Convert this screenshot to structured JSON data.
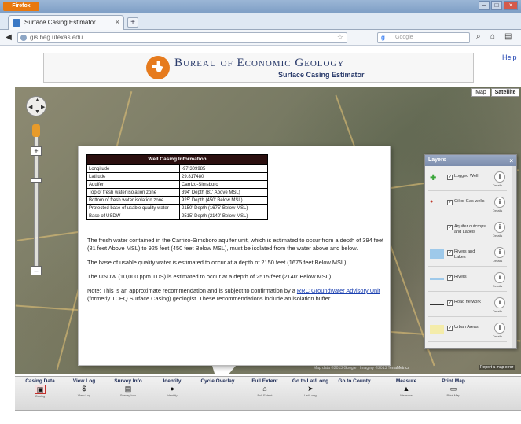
{
  "browser": {
    "app_button": "Firefox",
    "tab_title": "Surface Casing Estimator",
    "new_tab": "+",
    "url_prefix": "gis.beg.utexas.edu",
    "url_domain": "utexas.edu",
    "search_logo": "g",
    "search_placeholder": "Google"
  },
  "header": {
    "org_title": "Bureau of Economic Geology",
    "subtitle": "Surface Casing Estimator",
    "help_link": "Help"
  },
  "map": {
    "type_map": "Map",
    "type_satellite": "Satellite",
    "attribution": "Map data ©2013 Google · Imagery ©2013 TerraMetrics",
    "report_link": "Report a map error"
  },
  "well_info": {
    "title": "Well Casing Information",
    "rows": [
      {
        "label": "Longitude",
        "value": "-97.309985"
      },
      {
        "label": "Latitude",
        "value": "29.817480"
      },
      {
        "label": "Aquifer",
        "value": "Carrizo-Simsboro"
      },
      {
        "label": "Top of fresh water isolation zone",
        "value": "394' Depth (81' Above MSL)"
      },
      {
        "label": "Bottom of fresh water isolation zone",
        "value": "925' Depth (450' Below MSL)"
      },
      {
        "label": "Protected base of usable quality water",
        "value": "2150' Depth (1675' Below MSL)"
      },
      {
        "label": "Base of USDW",
        "value": "2515' Depth (2140' Below MSL)"
      }
    ],
    "para1": "The fresh water contained in the Carrizo-Simsboro aquifer unit, which is estimated to occur from a depth of 394 feet (81 feet Above MSL) to 925 feet (450 feet Below MSL), must be isolated from the water above and below.",
    "para2": "The base of usable quality water is estimated to occur at a depth of 2150 feet (1675 feet Below MSL).",
    "para3": "The USDW (10,000 ppm TDS) is estimated to occur at a depth of 2515 feet (2140' Below MSL).",
    "note_prefix": "Note: This is an approximate recommendation and is subject to confirmation by a ",
    "note_link": "RRC Groundwater Advisory Unit",
    "note_suffix": " (formerly TCEQ Surface Casing) geologist. These recommendations include an isolation buffer."
  },
  "layers": {
    "title": "Layers",
    "info_sub": "Details",
    "items": [
      {
        "label": "Logged Well",
        "color": "#3aa63a"
      },
      {
        "label": "Oil or Gas wells",
        "color": "#c0392b"
      },
      {
        "label": "Aquifer outcrops and Labels",
        "color": "#eeeeee"
      },
      {
        "label": "Rivers and Lakes",
        "color": "#9ec9ea"
      },
      {
        "label": "Rivers",
        "color": "#9ec9ea"
      },
      {
        "label": "Road network",
        "color": "#333333"
      },
      {
        "label": "Urban Areas",
        "color": "#f4ecaa"
      }
    ]
  },
  "toolbar": {
    "tools": [
      {
        "label": "Casing Data",
        "icon": "▣",
        "sub": "Casing"
      },
      {
        "label": "View Log",
        "icon": "$",
        "sub": "View Log"
      },
      {
        "label": "Survey Info",
        "icon": "▤",
        "sub": "Survey Info"
      },
      {
        "label": "Identify",
        "icon": "●",
        "sub": "Identify"
      },
      {
        "label": "Cycle Overlay",
        "icon": "",
        "sub": ""
      },
      {
        "label": "Full Extent",
        "icon": "⌂",
        "sub": "Full Extent"
      },
      {
        "label": "Go to Lat/Long",
        "icon": "➤",
        "sub": "Lat/Long"
      },
      {
        "label": "Go to County",
        "icon": "",
        "sub": ""
      },
      {
        "label": "Measure",
        "icon": "▲",
        "sub": "Measure"
      },
      {
        "label": "Print Map",
        "icon": "▭",
        "sub": "Print Map"
      }
    ]
  }
}
